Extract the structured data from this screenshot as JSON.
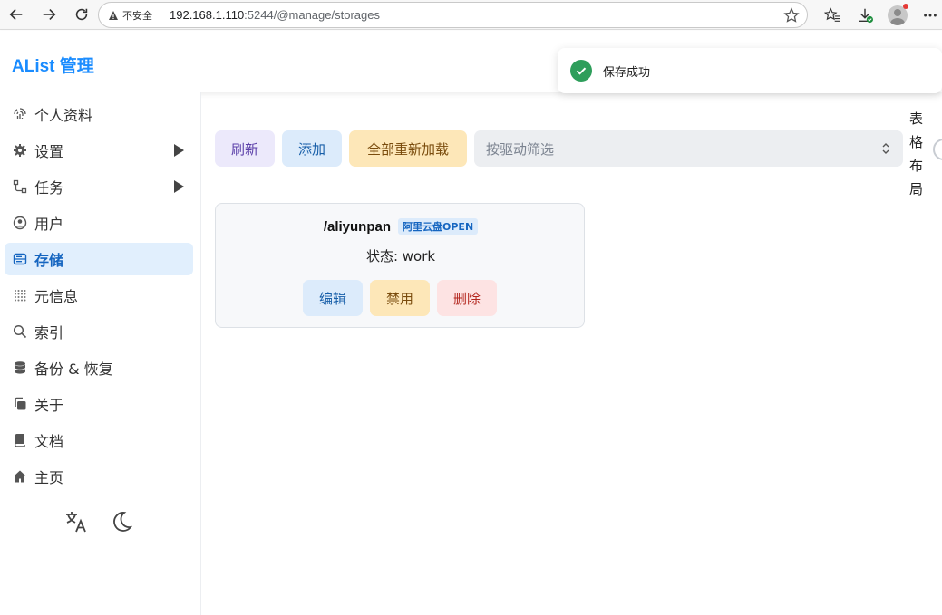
{
  "browser": {
    "security_label": "不安全",
    "url_host": "192.168.1.110",
    "url_rest": ":5244/@manage/storages"
  },
  "app": {
    "title": "AList 管理"
  },
  "toast": {
    "message": "保存成功"
  },
  "sidebar": {
    "items": [
      {
        "label": "个人资料",
        "icon": "fingerprint-icon",
        "expandable": false,
        "active": false
      },
      {
        "label": "设置",
        "icon": "gear-icon",
        "expandable": true,
        "active": false
      },
      {
        "label": "任务",
        "icon": "flow-icon",
        "expandable": true,
        "active": false
      },
      {
        "label": "用户",
        "icon": "user-circle-icon",
        "expandable": false,
        "active": false
      },
      {
        "label": "存储",
        "icon": "storage-icon",
        "expandable": false,
        "active": true
      },
      {
        "label": "元信息",
        "icon": "dots-grid-icon",
        "expandable": false,
        "active": false
      },
      {
        "label": "索引",
        "icon": "search-icon",
        "expandable": false,
        "active": false
      },
      {
        "label": "备份 & 恢复",
        "icon": "database-icon",
        "expandable": false,
        "active": false
      },
      {
        "label": "关于",
        "icon": "copy-icon",
        "expandable": false,
        "active": false
      },
      {
        "label": "文档",
        "icon": "book-icon",
        "expandable": false,
        "active": false
      },
      {
        "label": "主页",
        "icon": "home-icon",
        "expandable": false,
        "active": false
      }
    ],
    "bottom_icons": [
      "translate-icon",
      "moon-icon"
    ]
  },
  "toolbar": {
    "refresh_label": "刷新",
    "add_label": "添加",
    "reload_all_label": "全部重新加载",
    "filter_placeholder": "按驱动筛选",
    "layout_label": "表格布局"
  },
  "storages": [
    {
      "mount_path": "/aliyunpan",
      "driver": "阿里云盘OPEN",
      "status_text": "状态: work",
      "edit_label": "编辑",
      "disable_label": "禁用",
      "delete_label": "删除"
    }
  ],
  "colors": {
    "brand": "#1a8cff",
    "active_bg": "#e1effd",
    "success": "#2e9e5b"
  }
}
